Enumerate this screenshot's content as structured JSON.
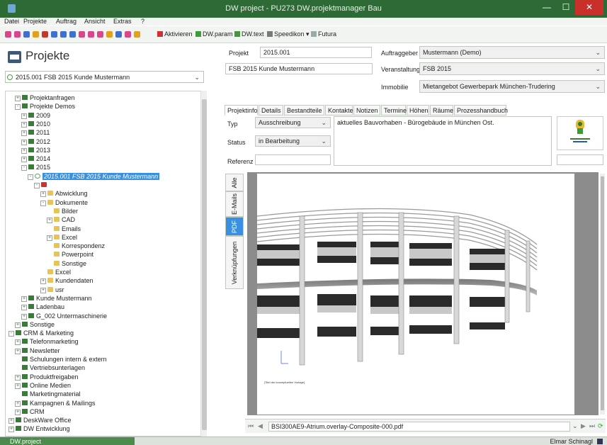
{
  "window": {
    "title": "DW project - PU273 DW.projektmanager Bau"
  },
  "menu": [
    "Datei",
    "Projekte",
    "Auftrag",
    "Ansicht",
    "Extras",
    "?"
  ],
  "toolbar": {
    "icon_colors": [
      "#d9468a",
      "#d9468a",
      "#3f6fd0",
      "#e0a020",
      "#c0392b",
      "#3f6fd0",
      "#3f6fd0",
      "#3f6fd0",
      "#d9468a",
      "#d9468a",
      "#d9468a",
      "#e0a020",
      "#3f6fd0",
      "#d9468a",
      "#e0a020",
      "#3f6fd0",
      "#3f6fd0",
      "#3f9a3f",
      "#3f9a3f"
    ],
    "aktivieren": "Aktivieren",
    "dwparam": "DW.param",
    "dwtext": "DW.text",
    "speedikon": "Speedikon",
    "futura": "Futura"
  },
  "left": {
    "header": "Projekte",
    "project_select": "2015.001 FSB 2015 Kunde Mustermann",
    "tree": [
      {
        "label": "Projektanfragen",
        "icon": "green",
        "level": 1,
        "exp": "+"
      },
      {
        "label": "Projekte Demos",
        "icon": "green",
        "level": 1,
        "exp": "-"
      },
      {
        "label": "2009",
        "icon": "green",
        "level": 2,
        "exp": "+"
      },
      {
        "label": "2010",
        "icon": "green",
        "level": 2,
        "exp": "+"
      },
      {
        "label": "2011",
        "icon": "green",
        "level": 2,
        "exp": "+"
      },
      {
        "label": "2012",
        "icon": "green",
        "level": 2,
        "exp": "+"
      },
      {
        "label": "2013",
        "icon": "green",
        "level": 2,
        "exp": "+"
      },
      {
        "label": "2014",
        "icon": "green",
        "level": 2,
        "exp": "+"
      },
      {
        "label": "2015",
        "icon": "green",
        "level": 2,
        "exp": "-"
      },
      {
        "label": "2015.001 FSB 2015 Kunde Mustermann",
        "icon": "dot",
        "level": 3,
        "exp": "-",
        "selected": true
      },
      {
        "label": "",
        "icon": "red",
        "level": 4,
        "exp": "-"
      },
      {
        "label": "Abwicklung",
        "icon": "folder",
        "level": 5,
        "exp": "+"
      },
      {
        "label": "Dokumente",
        "icon": "folder",
        "level": 5,
        "exp": "-"
      },
      {
        "label": "Bilder",
        "icon": "folder",
        "level": 6,
        "exp": ""
      },
      {
        "label": "CAD",
        "icon": "folder",
        "level": 6,
        "exp": "+"
      },
      {
        "label": "Emails",
        "icon": "folder",
        "level": 6,
        "exp": ""
      },
      {
        "label": "Excel",
        "icon": "folder",
        "level": 6,
        "exp": "+"
      },
      {
        "label": "Korrespondenz",
        "icon": "folder",
        "level": 6,
        "exp": ""
      },
      {
        "label": "Powerpoint",
        "icon": "folder",
        "level": 6,
        "exp": ""
      },
      {
        "label": "Sonstige",
        "icon": "folder",
        "level": 6,
        "exp": ""
      },
      {
        "label": "Excel",
        "icon": "folder",
        "level": 5,
        "exp": ""
      },
      {
        "label": "Kundendaten",
        "icon": "folder",
        "level": 5,
        "exp": "+"
      },
      {
        "label": "usr",
        "icon": "folder",
        "level": 5,
        "exp": "+"
      },
      {
        "label": "Kunde Mustermann",
        "icon": "green",
        "level": 2,
        "exp": "+"
      },
      {
        "label": "Ladenbau",
        "icon": "green",
        "level": 2,
        "exp": "+"
      },
      {
        "label": "G_002 Untermaschinerie",
        "icon": "green",
        "level": 2,
        "exp": "+"
      },
      {
        "label": "Sonstige",
        "icon": "green",
        "level": 1,
        "exp": "+"
      },
      {
        "label": "CRM & Marketing",
        "icon": "green",
        "level": 0,
        "exp": "-"
      },
      {
        "label": "Telefonmarketing",
        "icon": "green",
        "level": 1,
        "exp": "+"
      },
      {
        "label": "Newsletter",
        "icon": "green",
        "level": 1,
        "exp": "+"
      },
      {
        "label": "Schulungen intern & extern",
        "icon": "green",
        "level": 1,
        "exp": ""
      },
      {
        "label": "Vertriebsunterlagen",
        "icon": "green",
        "level": 1,
        "exp": ""
      },
      {
        "label": "Produktfreigaben",
        "icon": "green",
        "level": 1,
        "exp": "+"
      },
      {
        "label": "Online Medien",
        "icon": "green",
        "level": 1,
        "exp": "+"
      },
      {
        "label": "Marketingmaterial",
        "icon": "green",
        "level": 1,
        "exp": ""
      },
      {
        "label": "Kampagnen & Mailings",
        "icon": "green",
        "level": 1,
        "exp": "+"
      },
      {
        "label": "CRM",
        "icon": "green",
        "level": 1,
        "exp": "+"
      },
      {
        "label": "DeskWare Office",
        "icon": "green",
        "level": 0,
        "exp": "+"
      },
      {
        "label": "DW Entwicklung",
        "icon": "green",
        "level": 0,
        "exp": "+"
      }
    ]
  },
  "form": {
    "projekt_label": "Projekt",
    "projekt_value": "2015.001",
    "projekt_desc": "FSB 2015 Kunde Mustermann",
    "auftraggeber_label": "Auftraggeber",
    "auftraggeber_value": "Mustermann (Demo)",
    "veranstaltung_label": "Veranstaltung",
    "veranstaltung_value": "FSB 2015",
    "immobilie_label": "Immobilie",
    "immobilie_value": "Mietangebot Gewerbepark München-Trudering"
  },
  "tabs": [
    "Projektinfo",
    "Details",
    "Bestandteile",
    "Kontakte",
    "Notizen",
    "Termine",
    "Höhen",
    "Räume",
    "Prozesshandbuch"
  ],
  "projektinfo": {
    "typ_label": "Typ",
    "typ_value": "Ausschreibung",
    "status_label": "Status",
    "status_value": "in Bearbeitung",
    "referenz_label": "Referenz",
    "description": "aktuelles Bauvorhaben - Bürogebäude in München Ost."
  },
  "side_tabs": [
    "Alle",
    "E-Mails",
    "PDF",
    "Verknüpfungen"
  ],
  "pdf": {
    "file": "BSI300AE9-Atrium.overlay-Composite-000.pdf",
    "caption": "[Titel der konzeptuellen Vorlage]"
  },
  "status": {
    "left": "DW.project",
    "user": "Elmar Schinagl"
  }
}
